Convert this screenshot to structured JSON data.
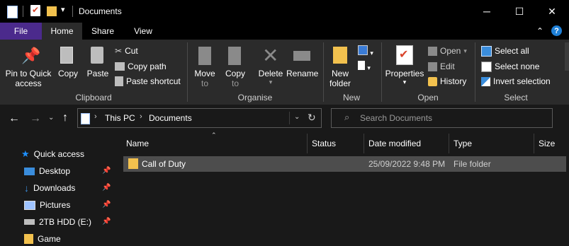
{
  "window": {
    "title": "Documents"
  },
  "tabs": {
    "file": "File",
    "home": "Home",
    "share": "Share",
    "view": "View"
  },
  "ribbon": {
    "clipboard": {
      "pin_label_1": "Pin to Quick",
      "pin_label_2": "access",
      "copy": "Copy",
      "paste": "Paste",
      "cut": "Cut",
      "copy_path": "Copy path",
      "paste_shortcut": "Paste shortcut",
      "group": "Clipboard"
    },
    "organise": {
      "move_to_1": "Move",
      "move_to_2": "to",
      "copy_to_1": "Copy",
      "copy_to_2": "to",
      "delete": "Delete",
      "rename": "Rename",
      "group": "Organise"
    },
    "new": {
      "folder_1": "New",
      "folder_2": "folder",
      "group": "New"
    },
    "open": {
      "properties": "Properties",
      "open": "Open",
      "edit": "Edit",
      "history": "History",
      "group": "Open"
    },
    "select": {
      "select_all": "Select all",
      "select_none": "Select none",
      "invert": "Invert selection",
      "group": "Select"
    }
  },
  "address": {
    "this_pc": "This PC",
    "documents": "Documents"
  },
  "search": {
    "placeholder": "Search Documents"
  },
  "columns": {
    "name": "Name",
    "status": "Status",
    "date": "Date modified",
    "type": "Type",
    "size": "Size"
  },
  "files": [
    {
      "name": "Call of Duty",
      "date": "25/09/2022 9:48 PM",
      "type": "File folder"
    }
  ],
  "nav": {
    "quick_access": "Quick access",
    "items": [
      {
        "label": "Desktop"
      },
      {
        "label": "Downloads"
      },
      {
        "label": "Pictures"
      },
      {
        "label": "2TB HDD (E:)"
      },
      {
        "label": "Game"
      }
    ]
  },
  "colors": {
    "accent": "#4b2a8c",
    "folder": "#f2c14e",
    "selected_row": "#4d4d4d",
    "star": "#1e90ff"
  }
}
